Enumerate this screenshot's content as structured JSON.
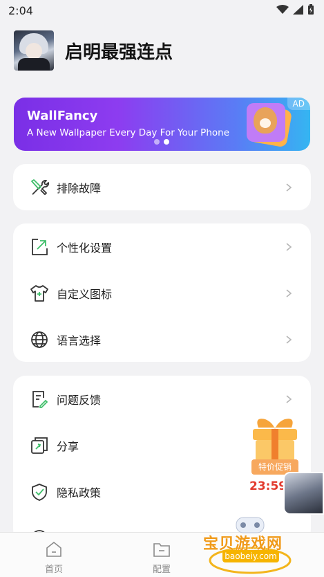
{
  "status_bar": {
    "time": "2:04"
  },
  "header": {
    "app_title": "启明最强连点"
  },
  "banner": {
    "title": "WallFancy",
    "subtitle": "A New Wallpaper Every Day For Your Phone",
    "ad_badge": "AD",
    "pages": 2,
    "active_page": 2
  },
  "menu": {
    "group1": [
      {
        "label": "排除故障",
        "icon": "tools-icon"
      }
    ],
    "group2": [
      {
        "label": "个性化设置",
        "icon": "personalize-icon"
      },
      {
        "label": "自定义图标",
        "icon": "tshirt-icon"
      },
      {
        "label": "语言选择",
        "icon": "globe-icon"
      }
    ],
    "group3": [
      {
        "label": "问题反馈",
        "icon": "feedback-icon"
      },
      {
        "label": "分享",
        "icon": "share-icon"
      },
      {
        "label": "隐私政策",
        "icon": "shield-icon"
      }
    ]
  },
  "promo": {
    "label": "特价促销",
    "countdown": "23:59:37"
  },
  "bottom_nav": [
    {
      "label": "首页",
      "icon": "home-icon"
    },
    {
      "label": "配置",
      "icon": "folder-icon"
    }
  ],
  "watermark": {
    "text": "宝贝游戏网",
    "domain": "baobeiy.com"
  },
  "colors": {
    "accent_green": "#3fbf6a",
    "countdown_red": "#e23a2e"
  }
}
